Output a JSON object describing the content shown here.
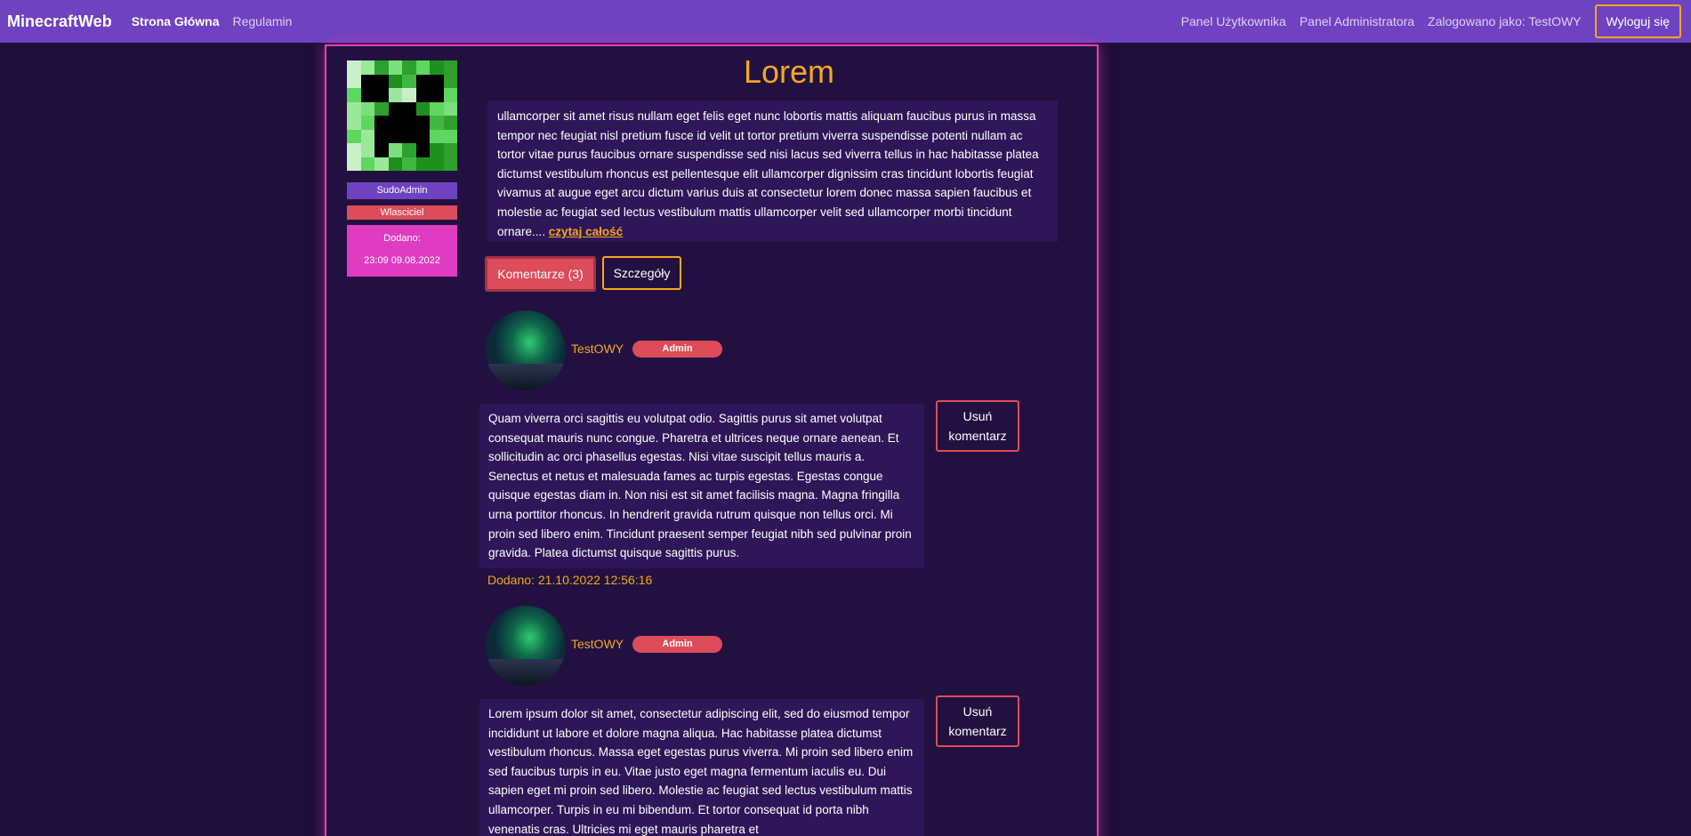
{
  "navbar": {
    "brand": "MinecraftWeb",
    "links": [
      "Strona Główna",
      "Regulamin"
    ],
    "right_links": [
      "Panel Użytkownika",
      "Panel Administratora"
    ],
    "logged_in": "Zalogowano jako: TestOWY",
    "logout_label": "Wyloguj się"
  },
  "post": {
    "title": "Lorem",
    "author": "SudoAdmin",
    "role": "Wlasciciel",
    "added_label": "Dodano:",
    "added_value": "23:09 09.08.2022",
    "body": "ullamcorper sit amet risus nullam eget felis eget nunc lobortis mattis aliquam faucibus purus in massa tempor nec feugiat nisl pretium fusce id velit ut tortor pretium viverra suspendisse potenti nullam ac tortor vitae purus faucibus ornare suspendisse sed nisi lacus sed viverra tellus in hac habitasse platea dictumst vestibulum rhoncus est pellentesque elit ullamcorper dignissim cras tincidunt lobortis feugiat vivamus at augue eget arcu dictum varius duis at consectetur lorem donec massa sapien faucibus et molestie ac feugiat sed lectus vestibulum mattis ullamcorper velit sed ullamcorper morbi tincidunt ornare....",
    "read_more": "czytaj całość",
    "comments_button": "Komentarze (3)",
    "details_button": "Szczegóły"
  },
  "comments": [
    {
      "author": "TestOWY",
      "role": "Admin",
      "body": "Quam viverra orci sagittis eu volutpat odio. Sagittis purus sit amet volutpat consequat mauris nunc congue. Pharetra et ultrices neque ornare aenean. Et sollicitudin ac orci phasellus egestas. Nisi vitae suscipit tellus mauris a. Senectus et netus et malesuada fames ac turpis egestas. Egestas congue quisque egestas diam in. Non nisi est sit amet facilisis magna. Magna fringilla urna porttitor rhoncus. In hendrerit gravida rutrum quisque non tellus orci. Mi proin sed libero enim. Tincidunt praesent semper feugiat nibh sed pulvinar proin gravida. Platea dictumst quisque sagittis purus.",
      "delete_label": "Usuń komentarz",
      "date": "Dodano: 21.10.2022 12:56:16"
    },
    {
      "author": "TestOWY",
      "role": "Admin",
      "body": "Lorem ipsum dolor sit amet, consectetur adipiscing elit, sed do eiusmod tempor incididunt ut labore et dolore magna aliqua. Hac habitasse platea dictumst vestibulum rhoncus. Massa eget egestas purus viverra. Mi proin sed libero enim sed faucibus turpis in eu. Vitae justo eget magna fermentum iaculis eu. Dui sapien eget mi proin sed libero. Molestie ac feugiat sed lectus vestibulum mattis ullamcorper. Turpis in eu mi bibendum. Et tortor consequat id porta nibh venenatis cras. Ultricies mi eget mauris pharetra et",
      "delete_label": "Usuń komentarz"
    }
  ],
  "colors": {
    "navbar": "#6f42c1",
    "accent": "#f5a623",
    "danger": "#dc4c5a",
    "card_border": "#e040b8",
    "background": "#1e0f3a"
  },
  "icons": {
    "post_avatar": "creeper-face-icon",
    "comment_avatar": "aurora-avatar-icon"
  }
}
